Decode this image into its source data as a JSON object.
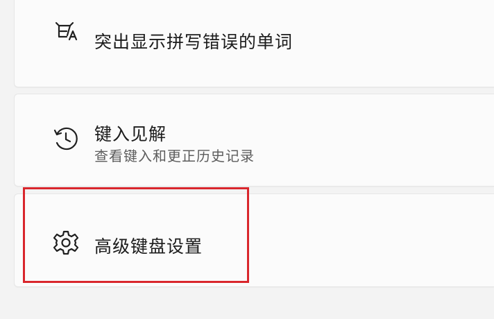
{
  "settings": {
    "items": [
      {
        "icon": "spellcheck-icon",
        "title": "突出显示拼写错误的单词"
      },
      {
        "icon": "history-icon",
        "title": "键入见解",
        "subtitle": "查看键入和更正历史记录"
      },
      {
        "icon": "gear-icon",
        "title": "高级键盘设置"
      }
    ]
  },
  "colors": {
    "background": "#f3f3f3",
    "card": "#fbfbfb",
    "highlight": "#d9262c"
  }
}
